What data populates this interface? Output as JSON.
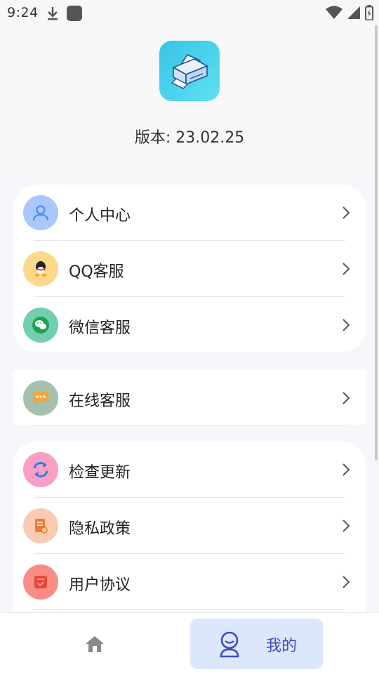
{
  "status_bar": {
    "time": "9:24",
    "icons_left": [
      "download-icon",
      "app-notification-icon"
    ],
    "icons_right": [
      "wifi-icon",
      "cell-signal-icon",
      "battery-icon"
    ]
  },
  "header": {
    "logo_icon": "printer-icon",
    "version": "版本: 23.02.25"
  },
  "menu_groups": [
    [
      {
        "label": "个人中心",
        "icon": "user-icon",
        "color": "#a9c7fb"
      },
      {
        "label": "QQ客服",
        "icon": "qq-penguin-icon",
        "color": "#fcd98a"
      },
      {
        "label": "微信客服",
        "icon": "wechat-icon",
        "color": "#71cfb0"
      }
    ],
    [
      {
        "label": "在线客服",
        "icon": "chat-bubble-icon",
        "color": "#a7bfae"
      }
    ],
    [
      {
        "label": "检查更新",
        "icon": "refresh-icon",
        "color": "#f99fc3"
      },
      {
        "label": "隐私政策",
        "icon": "document-icon",
        "color": "#f9cbb2"
      },
      {
        "label": "用户协议",
        "icon": "agreement-icon",
        "color": "#f98c85"
      }
    ]
  ],
  "bottom_nav": {
    "home_icon": "home-icon",
    "mine_label": "我的",
    "mine_icon": "profile-icon",
    "active_color": "#3a4cc4",
    "active_bg": "#dde7fb"
  }
}
